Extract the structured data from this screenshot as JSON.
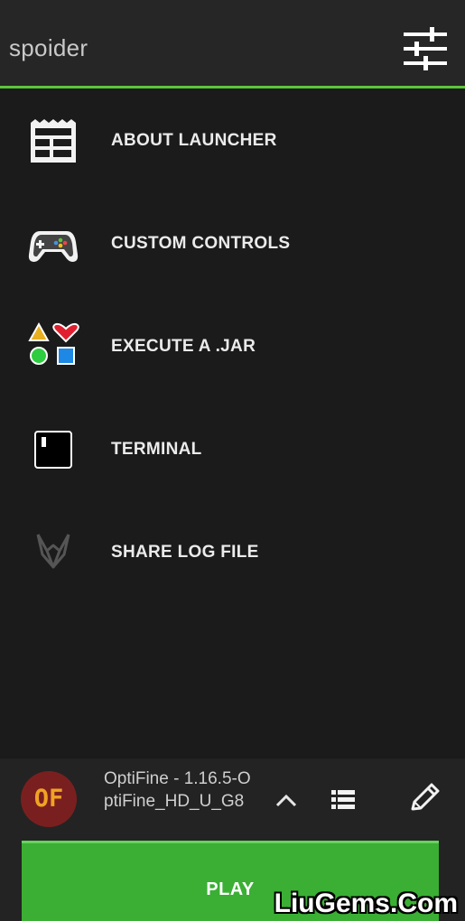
{
  "header": {
    "username": "spoider",
    "settings_icon": "sliders-icon"
  },
  "menu": {
    "items": [
      {
        "label": "ABOUT LAUNCHER",
        "icon": "news-icon"
      },
      {
        "label": "CUSTOM CONTROLS",
        "icon": "gamepad-icon"
      },
      {
        "label": "EXECUTE A .JAR",
        "icon": "shapes-icon"
      },
      {
        "label": "TERMINAL",
        "icon": "terminal-icon"
      },
      {
        "label": "SHARE LOG FILE",
        "icon": "share-icon"
      }
    ]
  },
  "profile": {
    "avatar_text": "OF",
    "name": "OptiFine - 1.16.5-OptiFine_HD_U_G8"
  },
  "play": {
    "label": "PLAY"
  },
  "watermark": "LiuGems.Com",
  "colors": {
    "accent": "#5cc53b",
    "play_button": "#3aaf34",
    "background": "#1b1b1b",
    "topbar": "#262626"
  }
}
